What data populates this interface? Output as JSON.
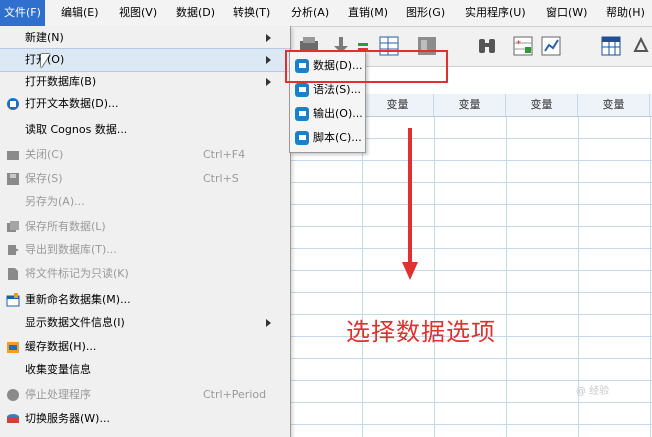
{
  "menubar": {
    "items": [
      {
        "label": "文件(F)",
        "active": true
      },
      {
        "label": "编辑(E)"
      },
      {
        "label": "视图(V)"
      },
      {
        "label": "数据(D)"
      },
      {
        "label": "转换(T)"
      },
      {
        "label": "分析(A)"
      },
      {
        "label": "直销(M)"
      },
      {
        "label": "图形(G)"
      },
      {
        "label": "实用程序(U)"
      },
      {
        "label": "窗口(W)"
      },
      {
        "label": "帮助(H)"
      }
    ]
  },
  "file_menu": {
    "items": [
      {
        "label": "新建(N)",
        "icon": "none",
        "submenu": true
      },
      {
        "label": "打开(O)",
        "icon": "none",
        "submenu": true,
        "highlighted": true
      },
      {
        "label": "打开数据库(B)",
        "icon": "none",
        "submenu": true
      },
      {
        "label": "打开文本数据(D)...",
        "icon": "text-data-icon"
      },
      {
        "label": "读取 Cognos 数据...",
        "icon": "none"
      },
      {
        "label": "关闭(C)",
        "icon": "folder-icon",
        "shortcut": "Ctrl+F4",
        "disabled": true
      },
      {
        "label": "保存(S)",
        "icon": "save-icon",
        "shortcut": "Ctrl+S",
        "disabled": true
      },
      {
        "label": "另存为(A)...",
        "icon": "none",
        "disabled": true
      },
      {
        "label": "保存所有数据(L)",
        "icon": "save-all-icon",
        "disabled": true
      },
      {
        "label": "导出到数据库(T)...",
        "icon": "export-db-icon",
        "disabled": true
      },
      {
        "label": "将文件标记为只读(K)",
        "icon": "readonly-icon",
        "disabled": true
      },
      {
        "label": "重新命名数据集(M)...",
        "icon": "rename-dataset-icon"
      },
      {
        "label": "显示数据文件信息(I)",
        "icon": "none",
        "submenu": true
      },
      {
        "label": "缓存数据(H)...",
        "icon": "cache-icon"
      },
      {
        "label": "收集变量信息",
        "icon": "none"
      },
      {
        "label": "停止处理程序",
        "icon": "stop-icon",
        "shortcut": "Ctrl+Period",
        "disabled": true
      },
      {
        "label": "切换服务器(W)...",
        "icon": "server-icon"
      }
    ]
  },
  "open_submenu": {
    "items": [
      {
        "label": "数据(D)..."
      },
      {
        "label": "语法(S)..."
      },
      {
        "label": "输出(O)..."
      },
      {
        "label": "脚本(C)..."
      }
    ]
  },
  "grid": {
    "headers": [
      "变量",
      "变量",
      "变量",
      "变量"
    ]
  },
  "annotation": {
    "text": "选择数据选项",
    "color": "#e03030"
  },
  "watermark": {
    "text": "@ 经验"
  },
  "colors": {
    "menu_active": "#2f6fce",
    "disabled_text": "#9a9a9a",
    "grid_line": "#c6d8ec"
  }
}
